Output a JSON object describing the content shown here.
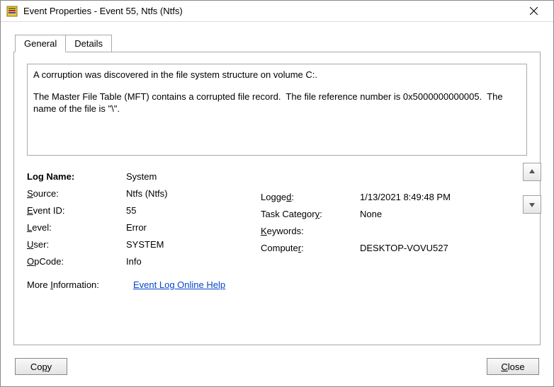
{
  "window": {
    "title": "Event Properties - Event 55, Ntfs (Ntfs)"
  },
  "tabs": {
    "general": "General",
    "details": "Details"
  },
  "description": {
    "line1": "A corruption was discovered in the file system structure on volume C:.",
    "line2": "The Master File Table (MFT) contains a corrupted file record.  The file reference number is 0x5000000000005.  The name of the file is \"\\\"."
  },
  "fields": {
    "logname_label": "Log Name:",
    "logname_value": "System",
    "source_label_pre": "S",
    "source_label_post": "ource:",
    "source_value": "Ntfs (Ntfs)",
    "logged_label_pre": "Logge",
    "logged_label_post": ":",
    "logged_letter": "d",
    "logged_value": "1/13/2021 8:49:48 PM",
    "eventid_label_pre": "",
    "eventid_letter": "E",
    "eventid_label_post": "vent ID:",
    "eventid_value": "55",
    "taskcat_label_pre": "Task Categor",
    "taskcat_letter": "y",
    "taskcat_label_post": ":",
    "taskcat_value": "None",
    "level_letter": "L",
    "level_label_post": "evel:",
    "level_value": "Error",
    "keywords_letter": "K",
    "keywords_label_post": "eywords:",
    "keywords_value": "",
    "user_letter": "U",
    "user_label_post": "ser:",
    "user_value": "SYSTEM",
    "computer_label_pre": "Compute",
    "computer_letter": "r",
    "computer_label_post": ":",
    "computer_value": "DESKTOP-VOVU527",
    "opcode_letter": "O",
    "opcode_label_post": "pCode:",
    "opcode_value": "Info",
    "moreinfo_label_pre": "More ",
    "moreinfo_letter": "I",
    "moreinfo_label_post": "nformation:",
    "moreinfo_link": "Event Log Online Help"
  },
  "buttons": {
    "copy_pre": "Co",
    "copy_letter": "p",
    "copy_post": "y",
    "close_letter": "C",
    "close_post": "lose"
  }
}
